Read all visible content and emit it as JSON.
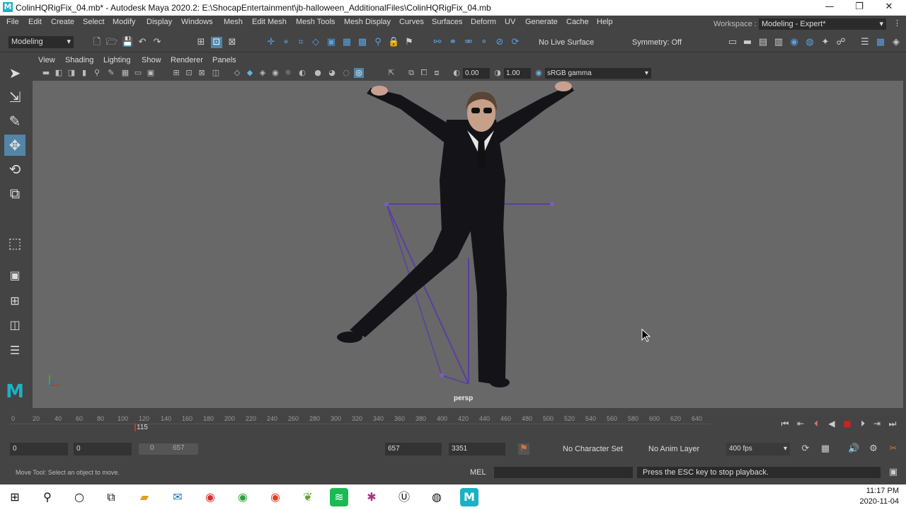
{
  "window": {
    "title": "ColinHQRigFix_04.mb* - Autodesk Maya 2020.2: E:\\ShocapEntertainment\\jb-halloween_AdditionalFiles\\ColinHQRigFix_04.mb",
    "logo": "M",
    "minimize": "—",
    "restore": "❐",
    "close": "✕"
  },
  "menubar": {
    "items": [
      "File",
      "Edit",
      "Create",
      "Select",
      "Modify",
      "Display",
      "Windows",
      "Mesh",
      "Edit Mesh",
      "Mesh Tools",
      "Mesh Display",
      "Curves",
      "Surfaces",
      "Deform",
      "UV",
      "Generate",
      "Cache",
      "Help"
    ],
    "workspace_label": "Workspace :",
    "workspace_value": "Modeling - Expert*"
  },
  "statusline": {
    "mode": "Modeling",
    "live_surface": "No Live Surface",
    "symmetry": "Symmetry: Off"
  },
  "panel": {
    "menus": [
      "View",
      "Shading",
      "Lighting",
      "Show",
      "Renderer",
      "Panels"
    ],
    "exposure": "0.00",
    "gamma": "1.00",
    "colorspace": "sRGB gamma",
    "camera": "persp"
  },
  "timeline": {
    "ticks": [
      "0",
      "20",
      "40",
      "60",
      "80",
      "100",
      "120",
      "140",
      "160",
      "180",
      "200",
      "220",
      "240",
      "260",
      "280",
      "300",
      "320",
      "340",
      "360",
      "380",
      "400",
      "420",
      "440",
      "460",
      "480",
      "500",
      "520",
      "540",
      "560",
      "580",
      "600",
      "620",
      "640"
    ],
    "current_frame": "115"
  },
  "range": {
    "start": "0",
    "anim_start": "0",
    "slider_start": "0",
    "slider_end": "657",
    "anim_end": "657",
    "end": "3351",
    "character_set": "No Character Set",
    "anim_layer": "No Anim Layer",
    "fps": "400 fps"
  },
  "cmdline": {
    "help": "Move Tool: Select an object to move.",
    "lang": "MEL",
    "message": "Press the ESC key to stop playback."
  },
  "taskbar": {
    "time": "11:17 PM",
    "date": "2020-11-04"
  }
}
